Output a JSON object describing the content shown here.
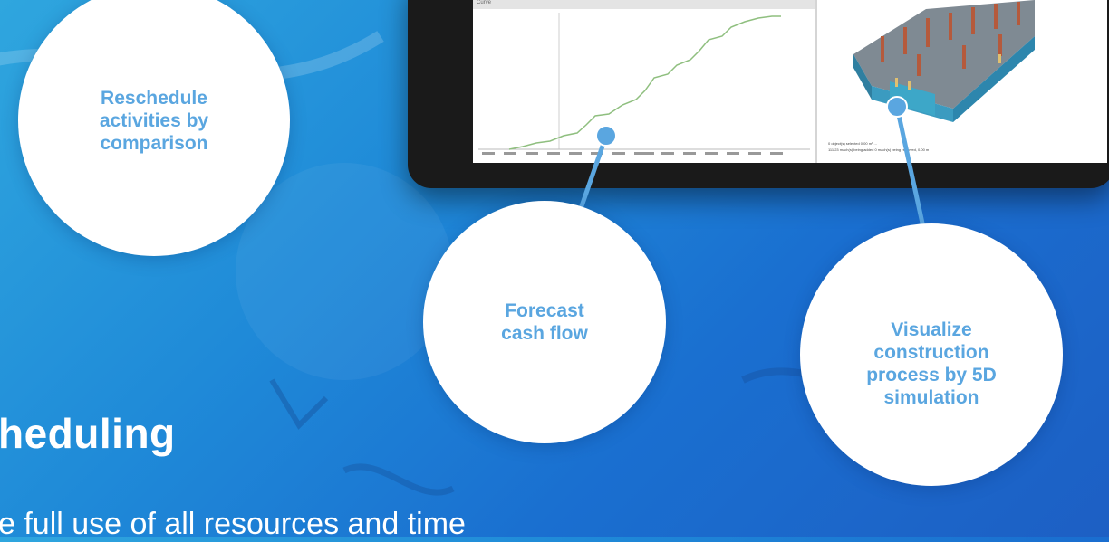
{
  "callouts": {
    "reschedule": "Reschedule\nactivities by\ncomparison",
    "cashflow": "Forecast\ncash flow",
    "simulation": "Visualize\nconstruction\nprocess by 5D\nsimulation"
  },
  "headline": "heduling",
  "subline": "e full use of all resources and time",
  "screen": {
    "chart_pane_title": "Curve",
    "status_line_1": "0 object(s) selected 0.00 m³ ...",
    "status_line_2": "111.23 mach(s) being added 0 mach(s) being removed, 0.00 m"
  },
  "colors": {
    "background": "#1f8ad8",
    "callout_text": "#5aa6e0",
    "marker": "#5aa6e0",
    "curve": "#8fbf7f"
  }
}
